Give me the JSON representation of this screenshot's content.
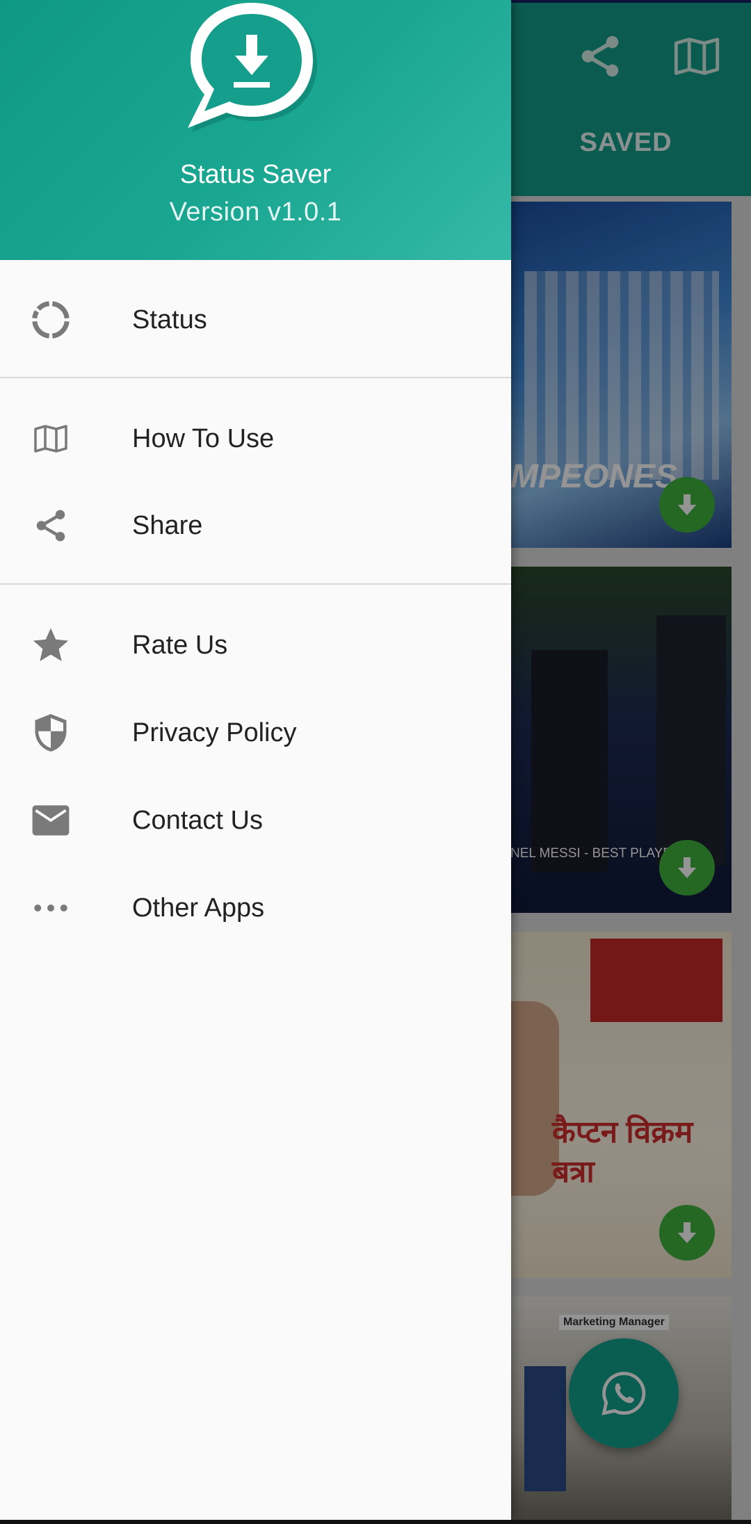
{
  "app": {
    "name": "Status Saver",
    "version": "Version v1.0.1"
  },
  "toolbar": {
    "share_icon": "share-icon",
    "guide_icon": "map-icon",
    "tab_saved": "SAVED"
  },
  "drawer": {
    "items": [
      {
        "label": "Status",
        "icon": "status-ring-icon"
      },
      {
        "label": "How To Use",
        "icon": "map-icon"
      },
      {
        "label": "Share",
        "icon": "share-icon"
      },
      {
        "label": "Rate Us",
        "icon": "star-icon"
      },
      {
        "label": "Privacy Policy",
        "icon": "shield-icon"
      },
      {
        "label": "Contact Us",
        "icon": "mail-icon"
      },
      {
        "label": "Other Apps",
        "icon": "more-dots-icon"
      }
    ]
  },
  "thumbnails": [
    {
      "caption": "MPEONES"
    },
    {
      "caption": "NEL MESSI - BEST PLAYER"
    },
    {
      "caption": "कैप्टन विक्रम बत्रा"
    },
    {
      "caption": "Marketing Manager"
    }
  ],
  "colors": {
    "primary": "#169e8c",
    "download_button": "#3fb33f",
    "drawer_background": "#fafafa"
  }
}
